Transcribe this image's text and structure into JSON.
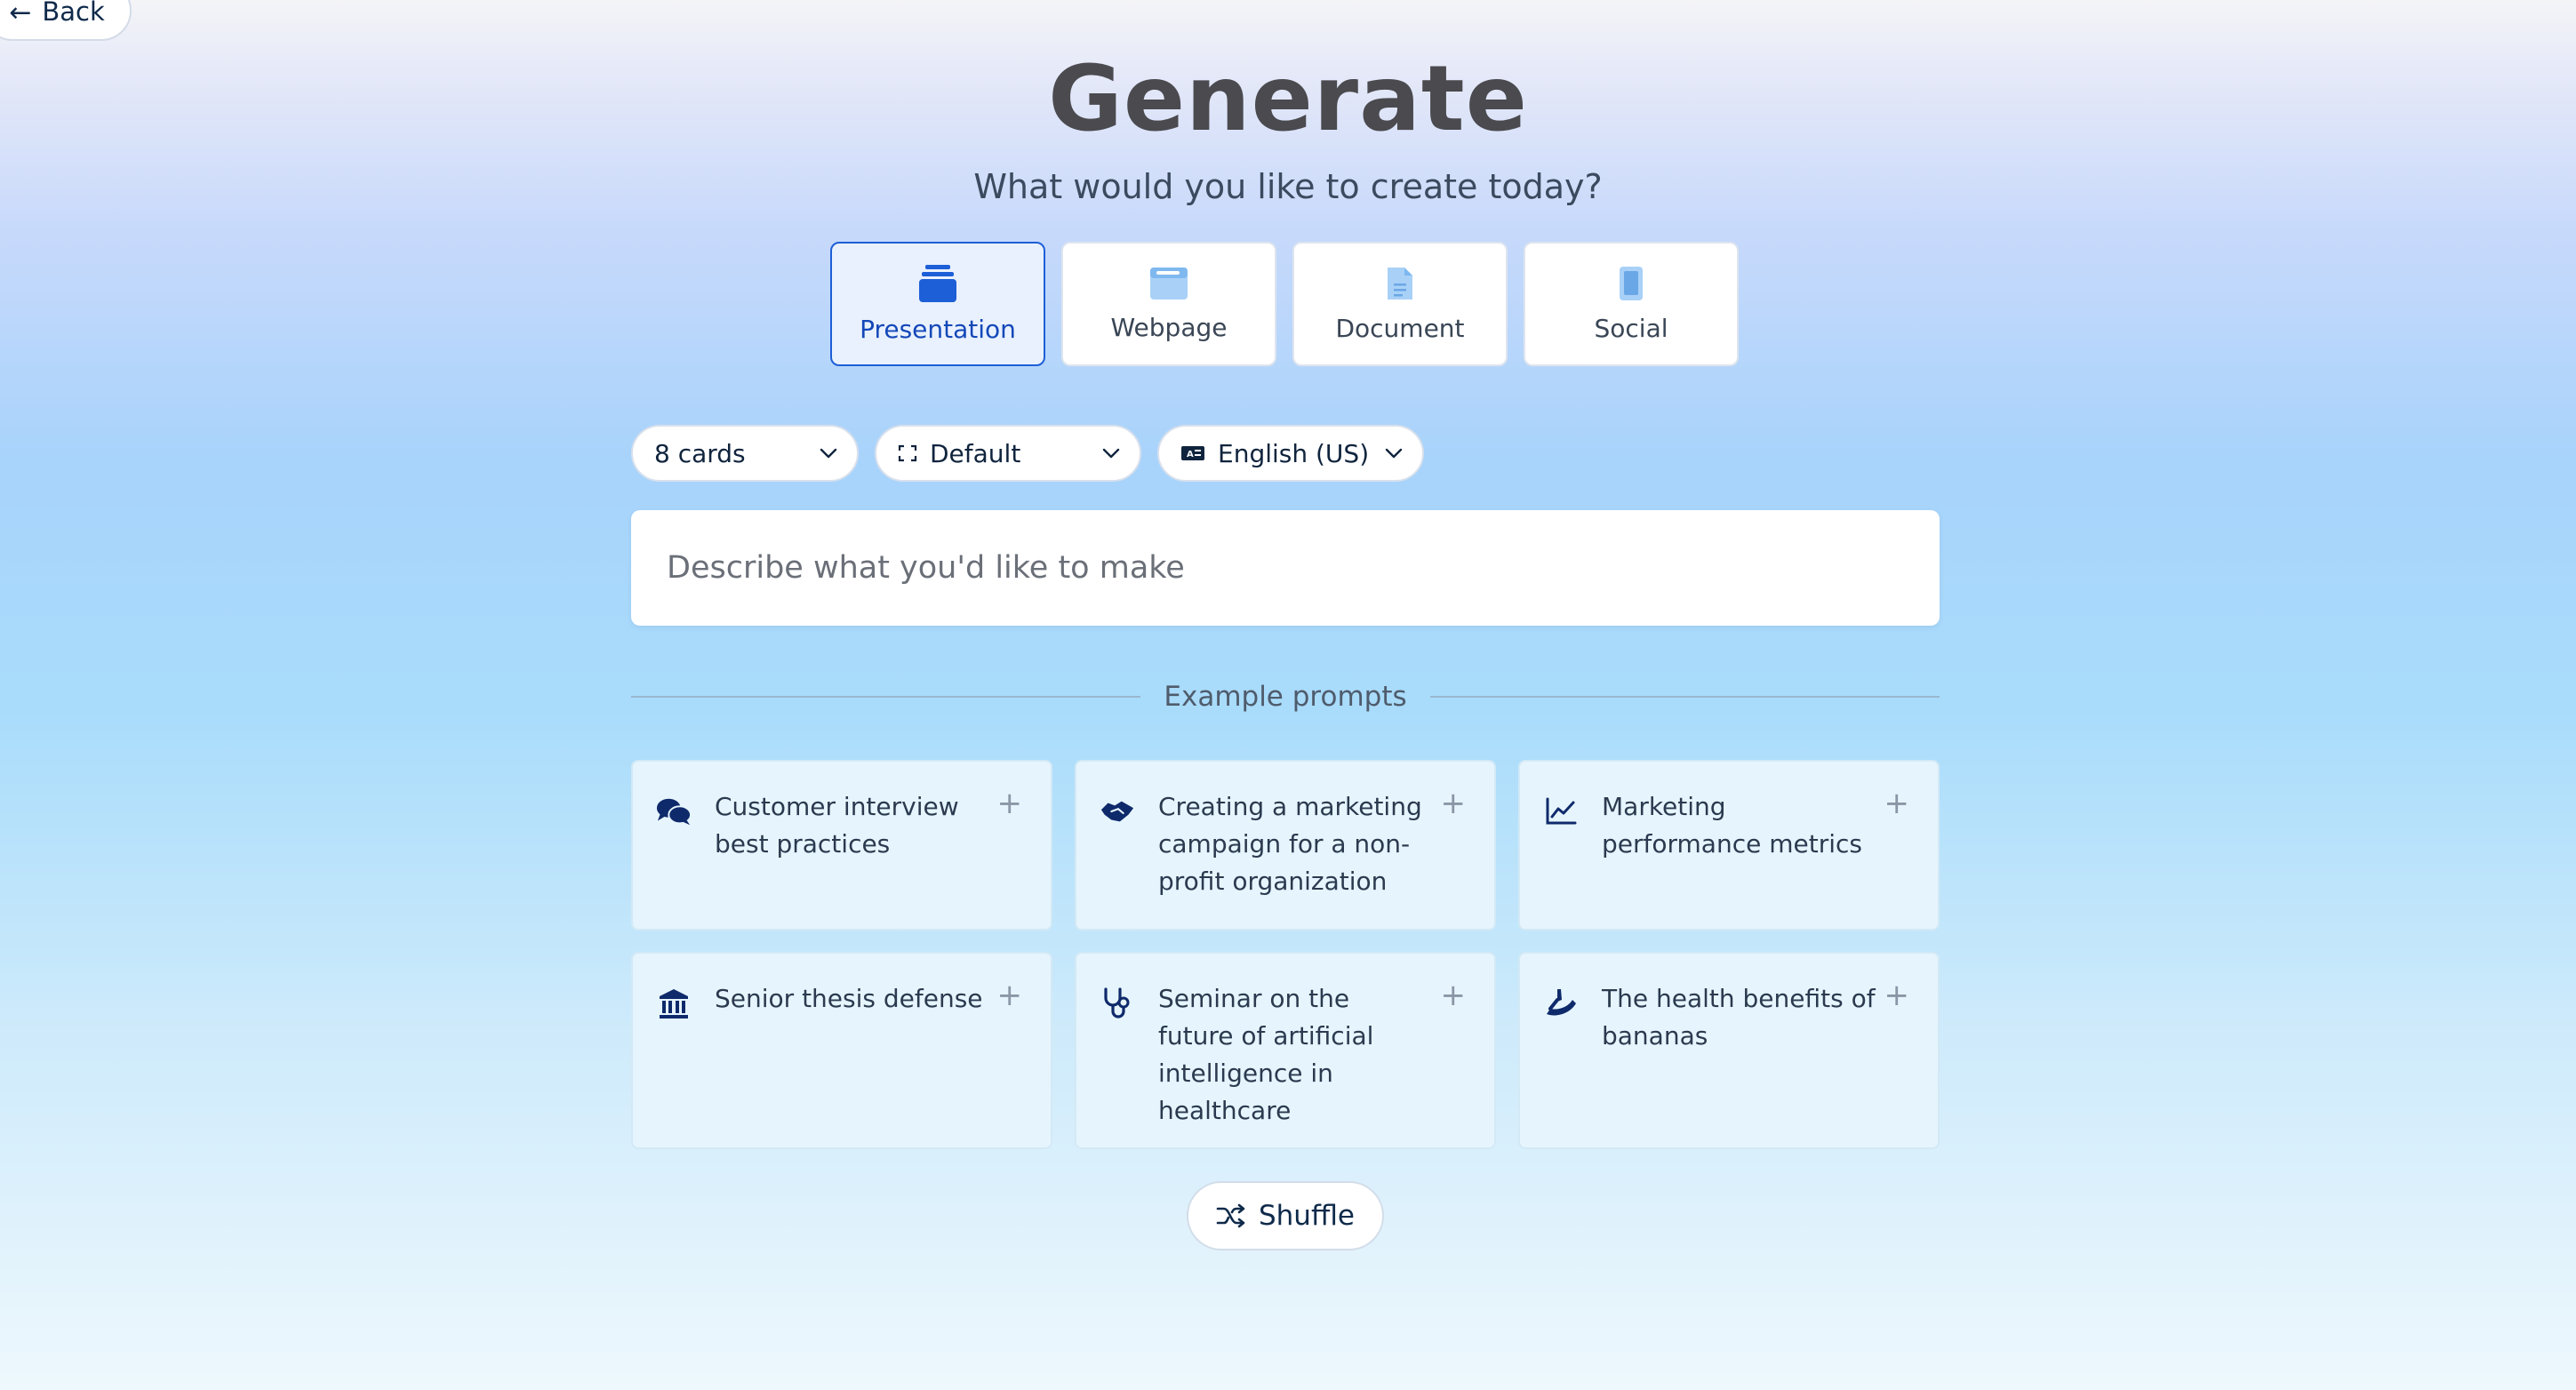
{
  "nav": {
    "back_label": "Back"
  },
  "header": {
    "title": "Generate",
    "subtitle": "What would you like to create today?"
  },
  "types": [
    {
      "label": "Presentation",
      "icon": "presentation-stack-icon",
      "selected": true
    },
    {
      "label": "Webpage",
      "icon": "webpage-icon",
      "selected": false
    },
    {
      "label": "Document",
      "icon": "document-icon",
      "selected": false
    },
    {
      "label": "Social",
      "icon": "phone-icon",
      "selected": false
    }
  ],
  "options": {
    "cards": "8 cards",
    "format": "Default",
    "language": "English (US)"
  },
  "prompt": {
    "placeholder": "Describe what you'd like to make",
    "value": ""
  },
  "examples": {
    "heading": "Example prompts",
    "items": [
      {
        "text": "Customer interview best practices",
        "icon": "chat-bubbles-icon"
      },
      {
        "text": "Creating a marketing campaign for a non-profit organization",
        "icon": "handshake-icon"
      },
      {
        "text": "Marketing performance metrics",
        "icon": "line-chart-icon"
      },
      {
        "text": "Senior thesis defense",
        "icon": "building-columns-icon"
      },
      {
        "text": "Seminar on the future of artificial intelligence in healthcare",
        "icon": "stethoscope-icon"
      },
      {
        "text": "The health benefits of bananas",
        "icon": "banana-icon"
      }
    ]
  },
  "shuffle_label": "Shuffle",
  "colors": {
    "accent": "#1d5fd6",
    "icon_dark": "#0f2a6b",
    "card_bg": "#e6f5fd"
  }
}
